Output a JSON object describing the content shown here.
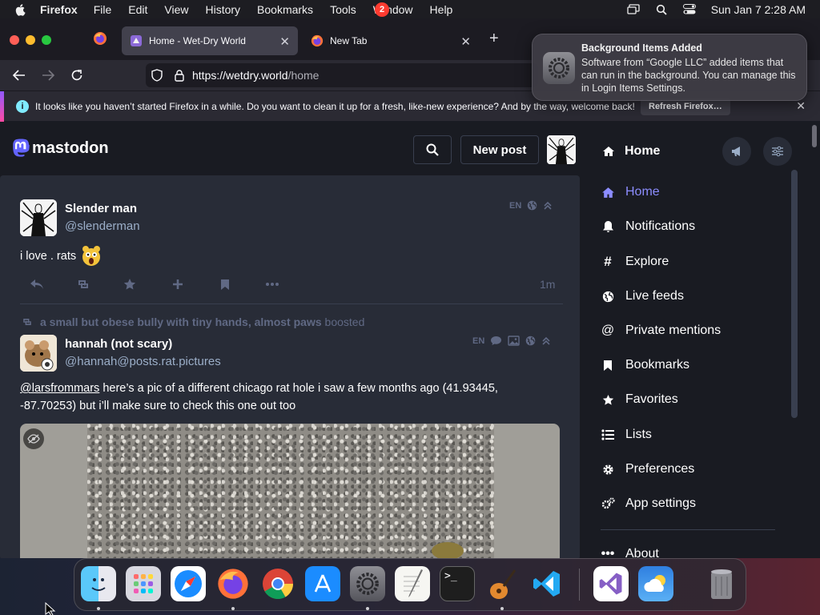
{
  "menubar": {
    "app": "Firefox",
    "items": [
      "File",
      "Edit",
      "View",
      "History",
      "Bookmarks",
      "Tools",
      "Window",
      "Help"
    ],
    "clock": "Sun Jan 7  2:28 AM"
  },
  "browser": {
    "tabs": [
      {
        "title": "Home - Wet-Dry World",
        "active": true
      },
      {
        "title": "New Tab",
        "active": false
      }
    ],
    "url_host": "https://wetdry.world",
    "url_path": "/home"
  },
  "infobar": {
    "message": "It looks like you haven’t started Firefox in a while. Do you want to clean it up for a fresh, like-new experience? And by the way, welcome back!",
    "button": "Refresh Firefox…"
  },
  "notification": {
    "title": "Background Items Added",
    "body": "Software from “Google LLC” added items that can run in the background. You can manage this in Login Items Settings."
  },
  "mastodon": {
    "logo_text": "mastodon",
    "new_post": "New post",
    "column_title": "Home",
    "nav": [
      {
        "label": "Home",
        "icon": "home-icon",
        "active": true
      },
      {
        "label": "Notifications",
        "icon": "bell-icon"
      },
      {
        "label": "Explore",
        "icon": "hashtag-icon"
      },
      {
        "label": "Live feeds",
        "icon": "globe-icon"
      },
      {
        "label": "Private mentions",
        "icon": "at-icon"
      },
      {
        "label": "Bookmarks",
        "icon": "bookmark-icon"
      },
      {
        "label": "Favorites",
        "icon": "star-icon"
      },
      {
        "label": "Lists",
        "icon": "list-icon"
      },
      {
        "label": "Preferences",
        "icon": "gear-icon"
      },
      {
        "label": "App settings",
        "icon": "gears-icon"
      },
      {
        "label": "About",
        "icon": "ellipsis-icon"
      }
    ],
    "posts": [
      {
        "display_name": "Slender man",
        "handle": "@slenderman",
        "lang": "EN",
        "text": "i love . rats",
        "time": "1m"
      },
      {
        "boosted_by": "a small but obese bully with tiny hands, almost paws",
        "boosted_word": "boosted",
        "display_name": "hannah (not scary)",
        "handle": "@hannah@posts.rat.pictures",
        "lang": "EN",
        "mention": "@larsfrommars",
        "text": " here’s a pic of a different chicago rat hole i saw a few months ago (41.93445, -87.70253) but i’ll make sure to check this one out too"
      }
    ]
  },
  "dock": {
    "apps": [
      "Finder",
      "Launchpad",
      "Safari",
      "Firefox",
      "Chrome",
      "App Store",
      "System Settings",
      "TextEdit",
      "Terminal",
      "GarageBand",
      "VS Code",
      "Visual Studio",
      "Weather",
      "Trash"
    ],
    "settings_badge": "2"
  }
}
